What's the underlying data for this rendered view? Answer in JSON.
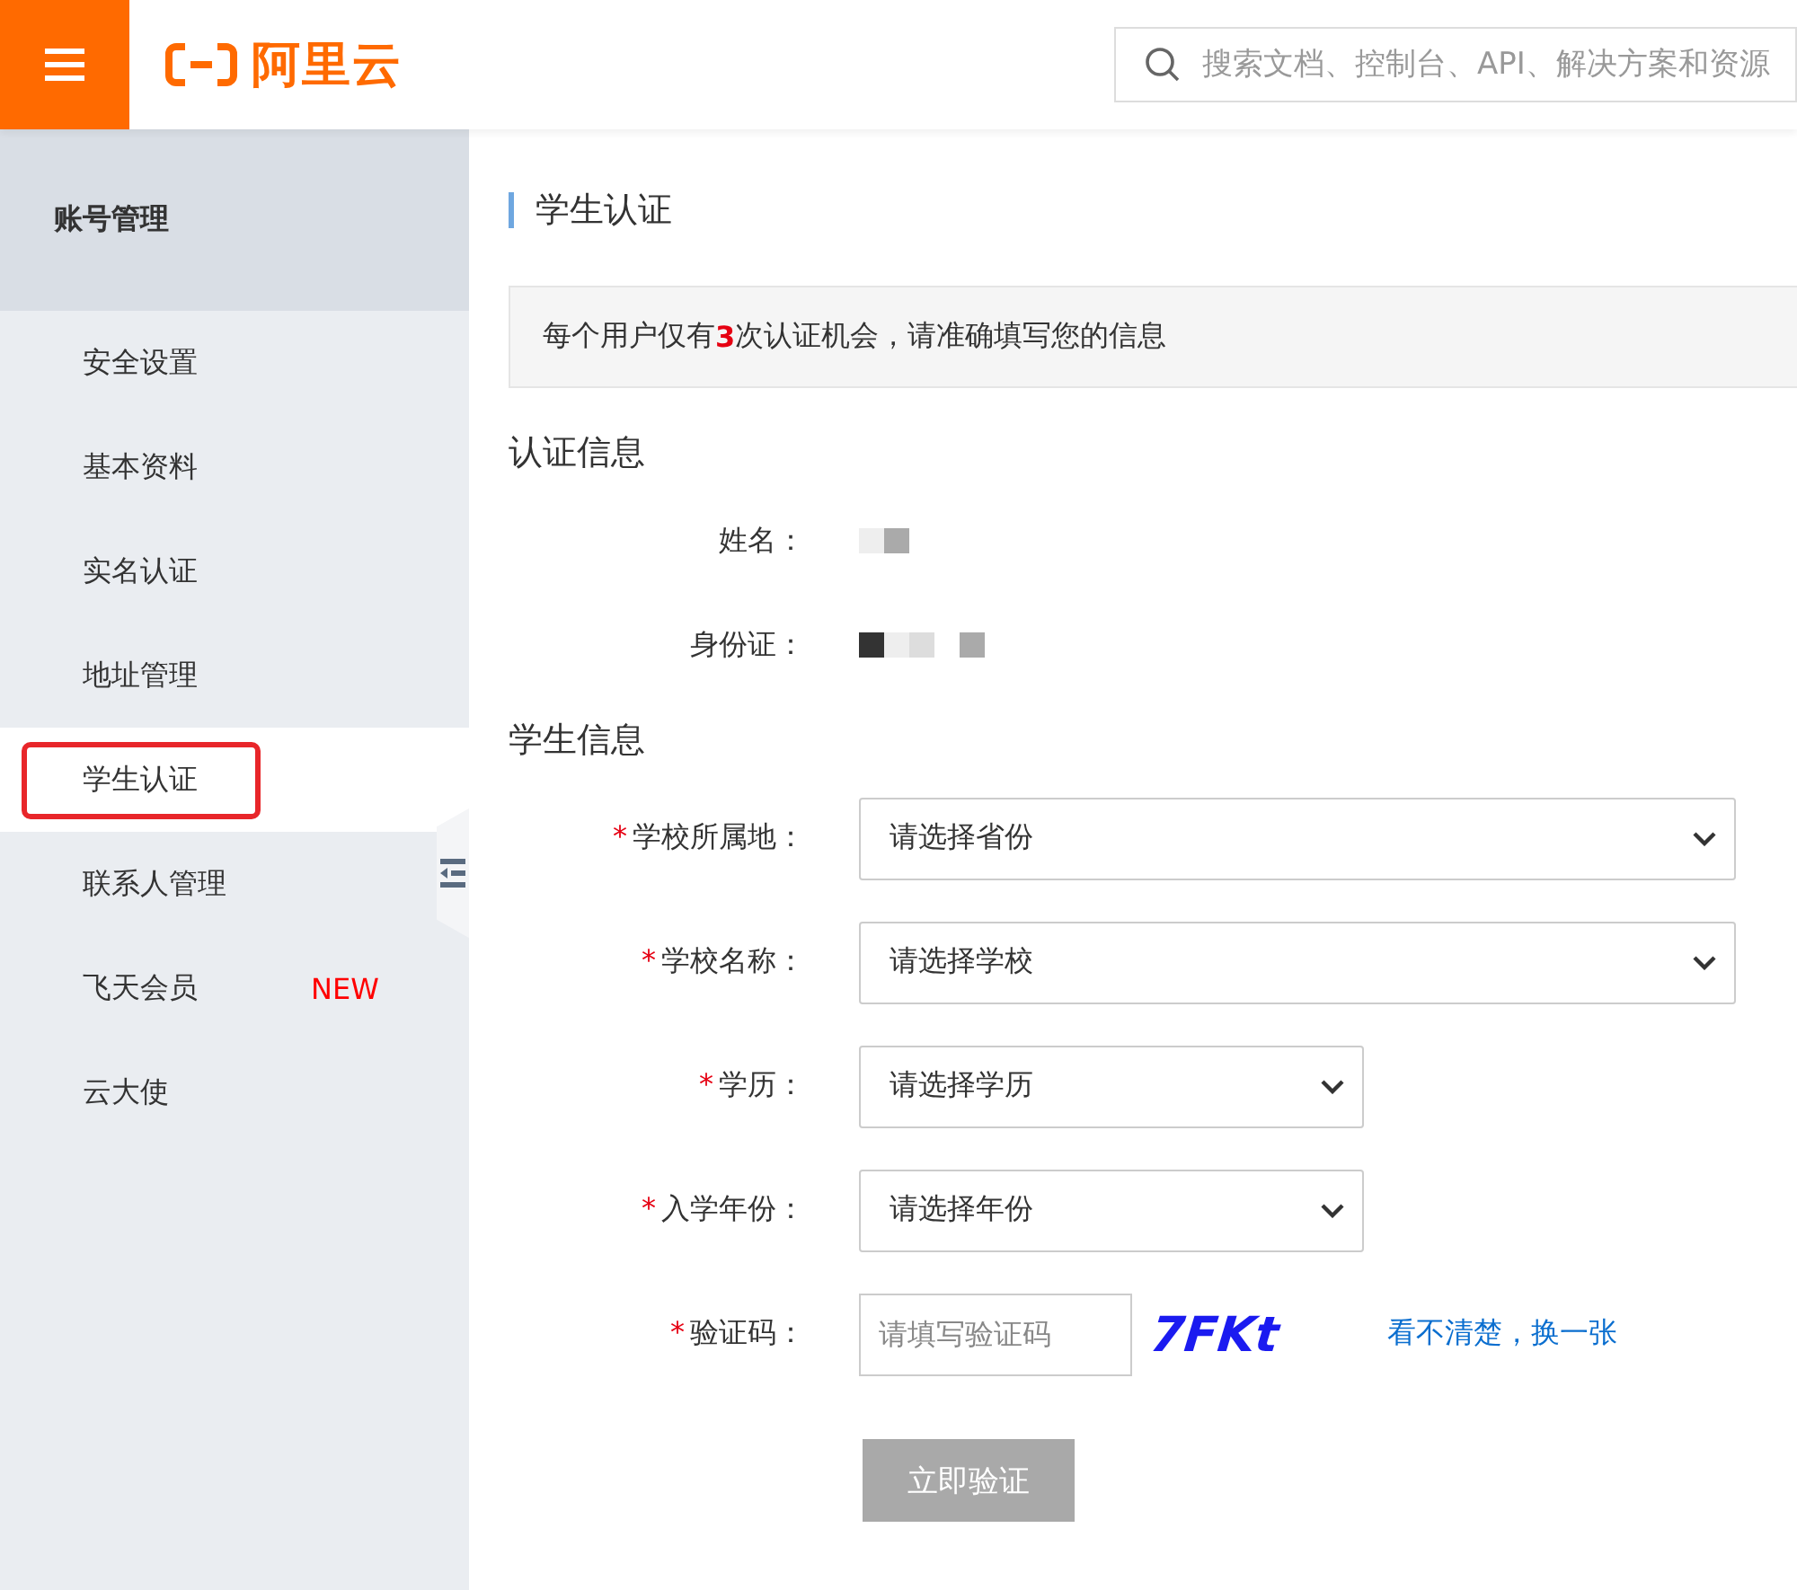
{
  "header": {
    "logo_text": "阿里云",
    "search": {
      "placeholder": "搜索文档、控制台、API、解决方案和资源"
    }
  },
  "sidebar": {
    "title": "账号管理",
    "items": [
      {
        "label": "安全设置",
        "selected": false
      },
      {
        "label": "基本资料",
        "selected": false
      },
      {
        "label": "实名认证",
        "selected": false
      },
      {
        "label": "地址管理",
        "selected": false
      },
      {
        "label": "学生认证",
        "selected": true
      },
      {
        "label": "联系人管理",
        "selected": false
      },
      {
        "label": "飞天会员",
        "selected": false,
        "badge": "NEW"
      },
      {
        "label": "云大使",
        "selected": false
      }
    ]
  },
  "page": {
    "title": "学生认证",
    "notice": "每个用户仅有**3**次认证机会，请准确填写您的信息",
    "sections": [
      {
        "heading": "认证信息",
        "fields": [
          {
            "label": "姓名：",
            "kind": "masked"
          },
          {
            "label": "身份证：",
            "kind": "masked"
          }
        ]
      },
      {
        "heading": "学生信息",
        "fields": [
          {
            "label": "学校所属地：",
            "kind": "select",
            "required_mark": "*",
            "placeholder": "请选择省份",
            "wide": true
          },
          {
            "label": "学校名称：",
            "kind": "select",
            "required_mark": "*",
            "placeholder": "请选择学校",
            "wide": true
          },
          {
            "label": "学历：",
            "kind": "select",
            "required_mark": "*",
            "placeholder": "请选择学历",
            "wide": false
          },
          {
            "label": "入学年份：",
            "kind": "select",
            "required_mark": "*",
            "placeholder": "请选择年份",
            "wide": false
          },
          {
            "label": "验证码：",
            "kind": "captcha",
            "required_mark": "*",
            "placeholder": "请填写验证码",
            "captcha_text": "7FKt",
            "refresh_link": "看不清楚，换一张"
          }
        ]
      }
    ],
    "submit": {
      "label": "立即验证",
      "disabled": true
    }
  }
}
